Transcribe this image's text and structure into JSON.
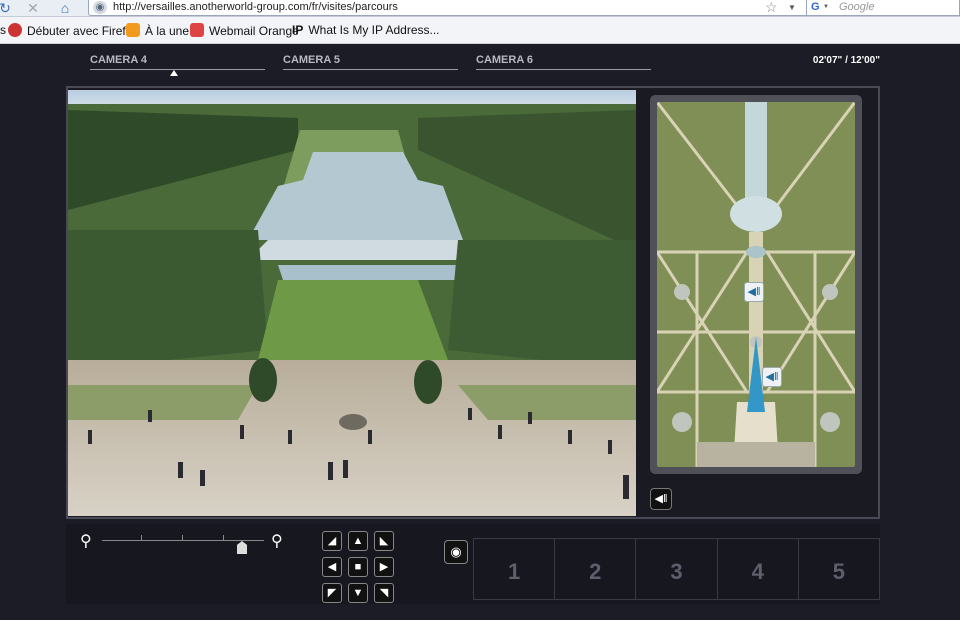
{
  "browser": {
    "url": "http://versailles.anotherworld-group.com/fr/visites/parcours",
    "search_placeholder": "Google",
    "search_engine_letter": "G",
    "bookmarks": [
      {
        "label": "Débuter avec Firefox",
        "icon": "firefox-icon",
        "color": "#c33"
      },
      {
        "label": "À la une",
        "icon": "rss-icon",
        "color": "#f29a1c"
      },
      {
        "label": "Webmail Orange",
        "icon": "webmail-icon",
        "color": "#d44"
      },
      {
        "label": "What Is My IP Address...",
        "icon": "ip-icon",
        "color": "#111"
      }
    ],
    "ip_glyph": "IP",
    "leading_fragment": "s"
  },
  "player": {
    "cameras": [
      "CAMERA 4",
      "CAMERA 5",
      "CAMERA 6"
    ],
    "active_camera_index": 0,
    "time": "02'07\" / 12'00\"",
    "slots": [
      "1",
      "2",
      "3",
      "4",
      "5"
    ],
    "zoom_level": 0.88
  },
  "colors": {
    "background": "#1c1c26",
    "accent_blue": "#1f8fc9"
  }
}
